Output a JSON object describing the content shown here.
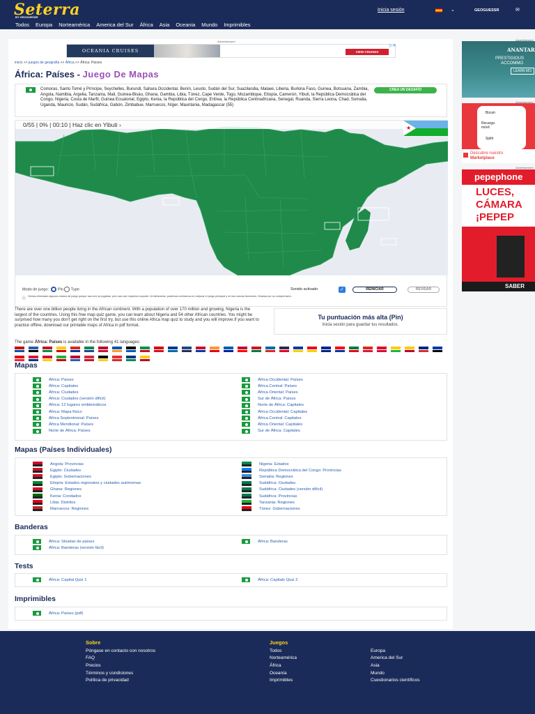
{
  "header": {
    "logo": "Seterra",
    "logo_sub": "BY GEOGUESSR",
    "login": "Inicia sesión",
    "geoguessr": "GEOGUESSR",
    "nav": [
      "Todos",
      "Europa",
      "Norteamérica",
      "America del Sur",
      "África",
      "Asia",
      "Oceania",
      "Mundo",
      "Imprimibles"
    ]
  },
  "ad_top": {
    "label": "Advertisement",
    "brand": "OCEANIA CRUISES",
    "cta": "VIEW CRUISES"
  },
  "breadcrumb": [
    "inicio",
    ">>",
    "juegos de geografía",
    ">>",
    "África",
    ">>",
    "África: Países"
  ],
  "title": {
    "main": "África: Países",
    "sub": "Juego De Mapas"
  },
  "description": "Comoras, Santo Tomé y Príncipe, Seychelles, Burundi, Sahara Occidental, Benín, Lesoto, Sudán del Sur, Suazilandia, Malawi, Liberia, Burkina Faso, Guinea, Botsuana, Zambia, Angola, Namibia, Argelia, Tanzania, Mali, Guinea-Bisáu, Ghana, Gambia, Libia, Túnez, Cape Verde, Togo, Mozambique, Etiopía, Camerún, Yibuti, la República Democrática del Congo, Nigeria, Costa de Marfil, Guinea Ecuatorial, Egipto, Kenia, la República del Congo, Eritrea, la República Centroafricana, Senegal, Ruanda, Sierra Leona, Chad, Somalia, Uganda, Mauricio, Sudán, Sudáfrica, Gabón, Zimbabue, Marruecos, Níger, Mauritania, Madagascar (55)",
  "challenge_btn": "CREA UN DESAFÍO",
  "game": {
    "score": "0/55",
    "percent": "0%",
    "timer": "00:10",
    "prompt": "Haz clic en Yibuti",
    "mode_label": "Modo de juego:",
    "mode_pin": "Pin",
    "mode_type": "Type",
    "sound": "Sonido activado",
    "restart": "REINICIAR",
    "review": "REVISAR",
    "notice": "Hemos eliminado algunos modos de juego porque rara vez se jugaban, pero aún así requerían soporte. Al eliminarlos, podemos centrarnos en mejorar el juego principal y en las nuevas funciones. Gracias por su comprensión."
  },
  "highscore": {
    "title": "Tu puntuación más alta (Pin)",
    "text": "Inicia sesión para guardar tus resultados."
  },
  "intro": "There are over one billion people living in the African continent. With a population of over 170 million and growing, Nigeria is the largest of the countries. Using this free map quiz game, you can learn about Nigeria and 54 other African countries. You might be surprised how many you don't get right on the first try, but use this online Africa map quiz to study and you will improve.If you want to practice offline, download our printable maps of Africa in pdf format.",
  "languages_text": {
    "pre": "The game ",
    "bold": "África: Países",
    "post": " is available in the following 41 languages:"
  },
  "lang_flags": [
    "#c00",
    "#2a5bb0",
    "#c8102e",
    "#ffce00",
    "#d52b1e",
    "#008751",
    "#bc002d",
    "#0055a4",
    "#000",
    "#009246",
    "#d00",
    "#003893",
    "#21468b",
    "#c8102e",
    "#ff9933",
    "#005bbb",
    "#c60c30",
    "#ce1126",
    "#006aa7",
    "#2d2a4a",
    "#0039a6",
    "#e70013",
    "#002395",
    "#ff0000",
    "#007a3d",
    "#da291c",
    "#e4002b",
    "#ffcc00",
    "#fecb00",
    "#00247d",
    "#0038a8",
    "#e30a17",
    "#dc143c",
    "#d21034",
    "#1eb53a",
    "#bc002d",
    "#cd2e3a",
    "#000",
    "#ed2939",
    "#003580",
    "#ffcd00"
  ],
  "sections": {
    "mapas": {
      "title": "Mapas",
      "left": [
        "África: Países",
        "África: Capitales",
        "África: Ciudades",
        "África: Ciudades (versión difícil)",
        "África: 12 lugares emblemáticos",
        "África: Mapa físico",
        "África Septentrional: Países",
        "África Meridional: Países",
        "Norte de África: Países"
      ],
      "right": [
        "África Occidental: Países",
        "África Central: Países",
        "África Oriental: Países",
        "Sur de África: Países",
        "Norte de África: Capitales",
        "África Occidental: Capitales",
        "África Central: Capitales",
        "África Oriental: Capitales",
        "Sur de África: Capitales"
      ]
    },
    "individuales": {
      "title": "Mapas (Países Individuales)",
      "left": [
        "Angola: Provincias",
        "Egipto: Ciudades",
        "Egipto: Gobernaciones",
        "Etiopía: Estados regionales y ciudades autónomas",
        "Ghana: Regiones",
        "Kenia: Condados",
        "Libia: Distritos",
        "Marruecos: Regiones"
      ],
      "right": [
        "Nigeria: Estados",
        "República Democrática del Congo: Provincias",
        "Somalia: Regiones",
        "Sudáfrica: Ciudades",
        "Sudáfrica: Ciudades (versión difícil)",
        "Sudáfrica: Provincias",
        "Tanzania: Regiones",
        "Túnez: Gobernaciones"
      ],
      "left_colors": [
        "#cc092f",
        "#ce1126",
        "#ce1126",
        "#078930",
        "#ce1126",
        "#006600",
        "#e70013",
        "#c1272d"
      ],
      "right_colors": [
        "#008751",
        "#007fff",
        "#4189dd",
        "#007a4d",
        "#007a4d",
        "#007a4d",
        "#1eb53a",
        "#e70013"
      ]
    },
    "banderas": {
      "title": "Banderas",
      "left": [
        "África: Siluetas de países",
        "África: Banderas (versión fácil)"
      ],
      "right": [
        "África: Banderas"
      ]
    },
    "tests": {
      "title": "Tests",
      "left": [
        "África: Capital Quiz 1"
      ],
      "right": [
        "África: Capitals Quiz 2"
      ]
    },
    "imprimibles": {
      "title": "Imprimibles",
      "left": [
        "África: Países (pdf)"
      ]
    }
  },
  "side_ads": {
    "label": "Advertisement",
    "ad1": {
      "brand": "ANANTARA",
      "line1": "PRESTIGIOUS",
      "line2": "ACCOMMO",
      "cta": "LEARN MO"
    },
    "ad2": {
      "item1": "Bizum",
      "item2": "Recarga móvil",
      "item3": "Splitt",
      "cta_line1": "Descubre nuestro",
      "cta_line2": "Marketplace"
    },
    "ad3": {
      "brand": "pepephone",
      "line1": "LUCES,",
      "line2": "CÁMARA",
      "line3": "¡PEPEP",
      "cta": "SABER"
    }
  },
  "footer": {
    "col1_title": "Sobre",
    "col1": [
      "Póngase en contacto con nosotros",
      "FAQ",
      "Precios",
      "Términos y condiciones",
      "Política de privacidad"
    ],
    "col2_title": "Juegos",
    "col2": [
      "Todos",
      "Norteamérica",
      "África",
      "Oceanía",
      "Imprimibles"
    ],
    "col3": [
      "Europa",
      "America del Sur",
      "Asia",
      "Mundo",
      "Cuestionarios científicos"
    ]
  },
  "colors": {
    "navy": "#1b2b59",
    "yellow": "#ffd324",
    "africa": "#1f8a4a",
    "link": "#2a5bb0",
    "purple": "#9c4fb8"
  }
}
